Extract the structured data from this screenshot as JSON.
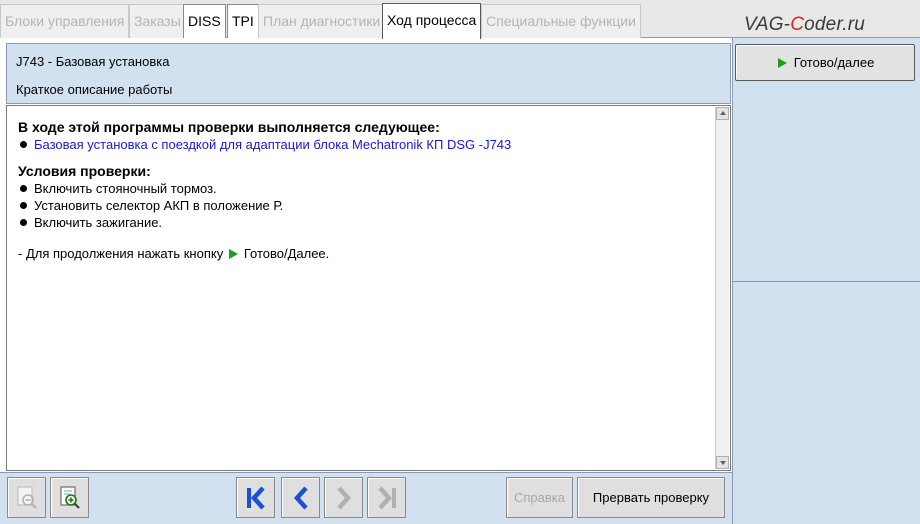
{
  "tabs": [
    {
      "label": "Блоки управления",
      "state": "disabled"
    },
    {
      "label": "Заказы",
      "state": "disabled"
    },
    {
      "label": "DISS",
      "state": "enabled"
    },
    {
      "label": "TPI",
      "state": "enabled"
    },
    {
      "label": "План диагностики",
      "state": "disabled"
    },
    {
      "label": "Ход процесса",
      "state": "active"
    },
    {
      "label": "Специальные функции",
      "state": "disabled"
    }
  ],
  "brand": {
    "prefix": "VAG-",
    "accent": "C",
    "suffix": "oder.ru"
  },
  "header": {
    "title": "J743 - Базовая установка",
    "subtitle": "Краткое описание работы"
  },
  "content": {
    "heading1": "В ходе этой программы проверки выполняется следующее:",
    "item1": "Базовая установка с поездкой для адаптации блока Mechatronik КП DSG -J743",
    "heading2": "Условия проверки:",
    "conditions": [
      "Включить стояночный тормоз.",
      "Установить селектор АКП в положение Р.",
      "Включить зажигание."
    ],
    "note_prefix": "- Для продолжения нажать кнопку",
    "note_button": "Готово/Далее."
  },
  "right_panel": {
    "next_button_label": "Готово/далее"
  },
  "bottom": {
    "help_label": "Справка",
    "abort_label": "Прервать проверку"
  },
  "colors": {
    "panel_bg": "#d2e1f0",
    "link_blue": "#1a1acc",
    "nav_blue": "#1a4fd8",
    "green_arrow": "#1aa01a",
    "brand_accent": "#e0231b"
  }
}
